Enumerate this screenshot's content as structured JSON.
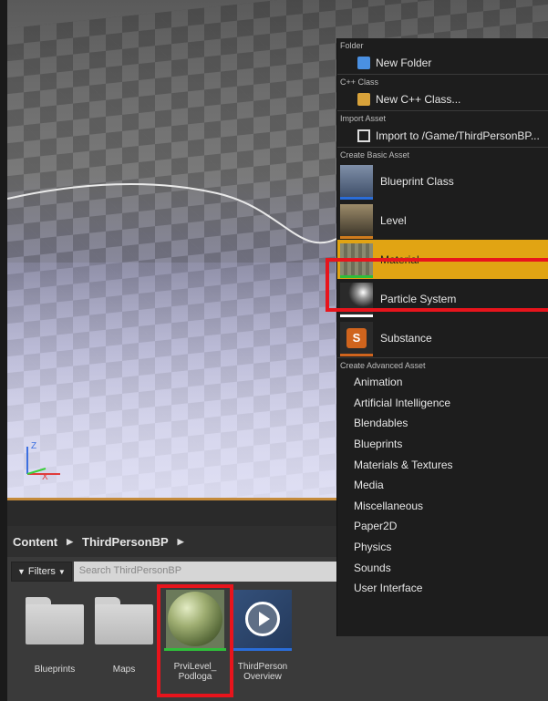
{
  "viewport": {
    "axis_z": "Z",
    "axis_x": "X"
  },
  "content_browser": {
    "breadcrumb": [
      "Content",
      "ThirdPersonBP"
    ],
    "filters_label": "Filters",
    "search_placeholder": "Search ThirdPersonBP",
    "assets": [
      {
        "label": "Blueprints",
        "type": "folder"
      },
      {
        "label": "Maps",
        "type": "folder"
      },
      {
        "label": "PrviLevel_ Podloga",
        "type": "material"
      },
      {
        "label": "ThirdPerson Overview",
        "type": "tutorial"
      }
    ]
  },
  "context_menu": {
    "folder_header": "Folder",
    "new_folder": "New Folder",
    "cpp_header": "C++ Class",
    "new_cpp": "New C++ Class...",
    "import_header": "Import Asset",
    "import_to": "Import to /Game/ThirdPersonBP...",
    "basic_header": "Create Basic Asset",
    "basic_items": [
      {
        "label": "Blueprint Class",
        "bar_color": "#2a6dd9"
      },
      {
        "label": "Level",
        "bar_color": "#d07c1d"
      },
      {
        "label": "Material",
        "bar_color": "#2fbf3a"
      },
      {
        "label": "Particle System",
        "bar_color": "#ffffff"
      },
      {
        "label": "Substance",
        "bar_color": "#d0641d"
      }
    ],
    "advanced_header": "Create Advanced Asset",
    "advanced_items": [
      "Animation",
      "Artificial Intelligence",
      "Blendables",
      "Blueprints",
      "Materials & Textures",
      "Media",
      "Miscellaneous",
      "Paper2D",
      "Physics",
      "Sounds",
      "User Interface"
    ]
  },
  "colors": {
    "selection": "#e1a413",
    "highlight_box": "#e8141c"
  }
}
